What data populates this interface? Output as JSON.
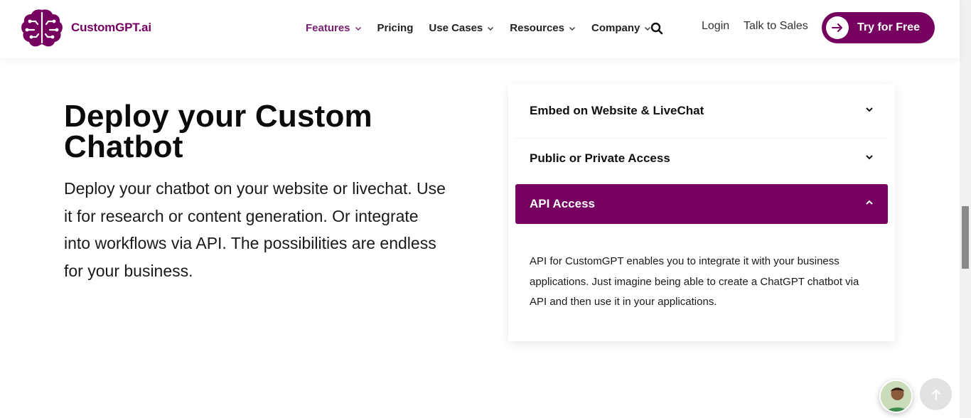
{
  "brand": {
    "name": "CustomGPT.ai",
    "color": "#75005f"
  },
  "nav": {
    "items": [
      {
        "label": "Features",
        "dropdown": true,
        "active": true
      },
      {
        "label": "Pricing",
        "dropdown": false
      },
      {
        "label": "Use Cases",
        "dropdown": true
      },
      {
        "label": "Resources",
        "dropdown": true
      },
      {
        "label": "Company",
        "dropdown": true
      }
    ],
    "search_icon": "search-icon",
    "login": "Login",
    "talk_to_sales": "Talk to Sales",
    "cta": "Try for Free"
  },
  "hero": {
    "title": "Deploy your Custom Chatbot",
    "description": "Deploy your chatbot on your website or livechat. Use it for research or content generation. Or integrate into workflows via API. The possibilities are endless for your business."
  },
  "accordion": {
    "items": [
      {
        "title": "Embed on Website & LiveChat",
        "expanded": false
      },
      {
        "title": "Public or Private Access",
        "expanded": false
      },
      {
        "title": "API Access",
        "expanded": true
      }
    ],
    "active_body": "API for CustomGPT enables you to integrate it with your business applications. Just imagine being able to create a ChatGPT chatbot via API and then use it in your applications."
  },
  "widgets": {
    "chat_avatar": "chat-avatar",
    "back_to_top": "arrow-up-icon"
  }
}
